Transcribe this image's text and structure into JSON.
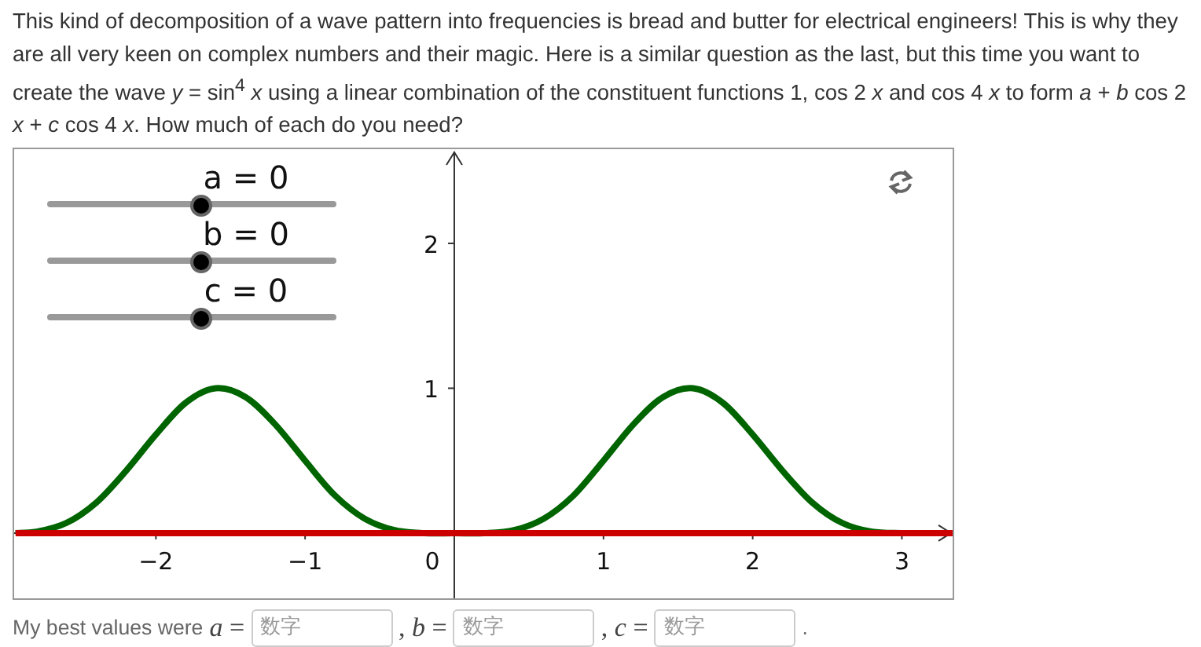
{
  "intro": "This kind of decomposition of a wave pattern into frequencies is bread and butter for electrical engineers! This is why they are all very keen on complex numbers and their magic. Here is a similar question as the last, but this time you want to create the wave *y* = sin$^{4}$ *x*  using a linear combination of the constituent functions 1, cos 2 *x*  and cos 4 *x*  to form *a* + *b* cos 2 *x* + *c* cos 4 *x*.  How much of each do you need?",
  "applet": {
    "sliders": [
      {
        "label": "a = 0",
        "level": 0.5
      },
      {
        "label": "b = 0",
        "level": 0.5
      },
      {
        "label": "c = 0",
        "level": 0.5
      }
    ],
    "origin_label": "0",
    "chart_data": {
      "type": "line",
      "xlim": [
        -2.95,
        3.34
      ],
      "ylim": [
        -0.45,
        2.65
      ],
      "xticks": [
        {
          "value": -2,
          "label": "−2"
        },
        {
          "value": -1,
          "label": "−1"
        },
        {
          "value": 1,
          "label": "1"
        },
        {
          "value": 2,
          "label": "2"
        },
        {
          "value": 3,
          "label": "3"
        }
      ],
      "yticks": [
        {
          "value": 1,
          "label": "1"
        },
        {
          "value": 2,
          "label": "2"
        }
      ],
      "x": [
        -2.94,
        -2.8,
        -2.6,
        -2.4,
        -2.2,
        -2.0,
        -1.8,
        -1.6,
        -1.4,
        -1.2,
        -1.0,
        -0.8,
        -0.6,
        -0.4,
        -0.2,
        0,
        0.2,
        0.4,
        0.6,
        0.8,
        1.0,
        1.2,
        1.4,
        1.6,
        1.8,
        2.0,
        2.2,
        2.4,
        2.6,
        2.8,
        3.0,
        3.2,
        3.34
      ],
      "series": [
        {
          "color": "#006400",
          "values": [
            0,
            0.01,
            0.07,
            0.21,
            0.43,
            0.68,
            0.9,
            1.0,
            0.94,
            0.75,
            0.5,
            0.26,
            0.1,
            0.02,
            0,
            0,
            0,
            0.02,
            0.1,
            0.26,
            0.5,
            0.75,
            0.94,
            1.0,
            0.9,
            0.68,
            0.43,
            0.21,
            0.07,
            0.01,
            0,
            0,
            0
          ]
        },
        {
          "color": "#cc0000",
          "values": [
            0,
            0,
            0,
            0,
            0,
            0,
            0,
            0,
            0,
            0,
            0,
            0,
            0,
            0,
            0,
            0,
            0,
            0,
            0,
            0,
            0,
            0,
            0,
            0,
            0,
            0,
            0,
            0,
            0,
            0,
            0,
            0,
            0
          ]
        }
      ]
    }
  },
  "answer": {
    "prefix": "My best values were",
    "fields": [
      {
        "label": "*a* =",
        "placeholder": "数字"
      },
      {
        "label": ", *b* =",
        "placeholder": "数字"
      },
      {
        "label": ", *c* =",
        "placeholder": "数字"
      }
    ],
    "suffix": "."
  }
}
